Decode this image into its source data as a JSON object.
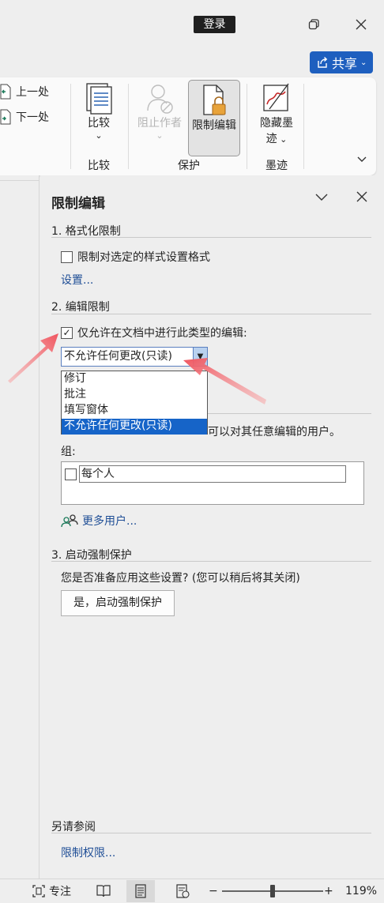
{
  "titlebar": {
    "login_label": "登录",
    "share_label": "共享"
  },
  "ribbon": {
    "prev_label": "上一处",
    "next_label": "下一处",
    "compare_label": "比较",
    "compare_group": "比较",
    "block_authors_label": "阻止作者",
    "restrict_editing_label": "限制编辑",
    "protect_group": "保护",
    "hide_ink_label_1": "隐藏墨",
    "hide_ink_label_2": "迹",
    "ink_group": "墨迹"
  },
  "pane": {
    "title": "限制编辑",
    "section1_title": "1. 格式化限制",
    "format_checkbox_label": "限制对选定的样式设置格式",
    "format_checked": false,
    "settings_link": "设置...",
    "section2_title": "2. 编辑限制",
    "editing_checkbox_label": "仅允许在文档中进行此类型的编辑:",
    "editing_checked": true,
    "selected_mode": "不允许任何更改(只读)",
    "dropdown_options": [
      "修订",
      "批注",
      "填写窗体",
      "不允许任何更改(只读)"
    ],
    "exceptions_partial": "可以对其任意编辑的用户。",
    "groups_label": "组:",
    "group_name": "每个人",
    "more_users_link": "更多用户...",
    "section3_title": "3. 启动强制保护",
    "prompt_text": "您是否准备应用这些设置? (您可以稍后将其关闭)",
    "start_button": "是，启动强制保护",
    "see_also_title": "另请参阅",
    "permissions_link": "限制权限..."
  },
  "statusbar": {
    "focus_label": "专注",
    "zoom_minus": "−",
    "zoom_plus": "+",
    "zoom_level": "119%"
  },
  "colors": {
    "accent": "#1e5fbf",
    "selection": "#1664c8",
    "arrow": "#f0555f"
  }
}
